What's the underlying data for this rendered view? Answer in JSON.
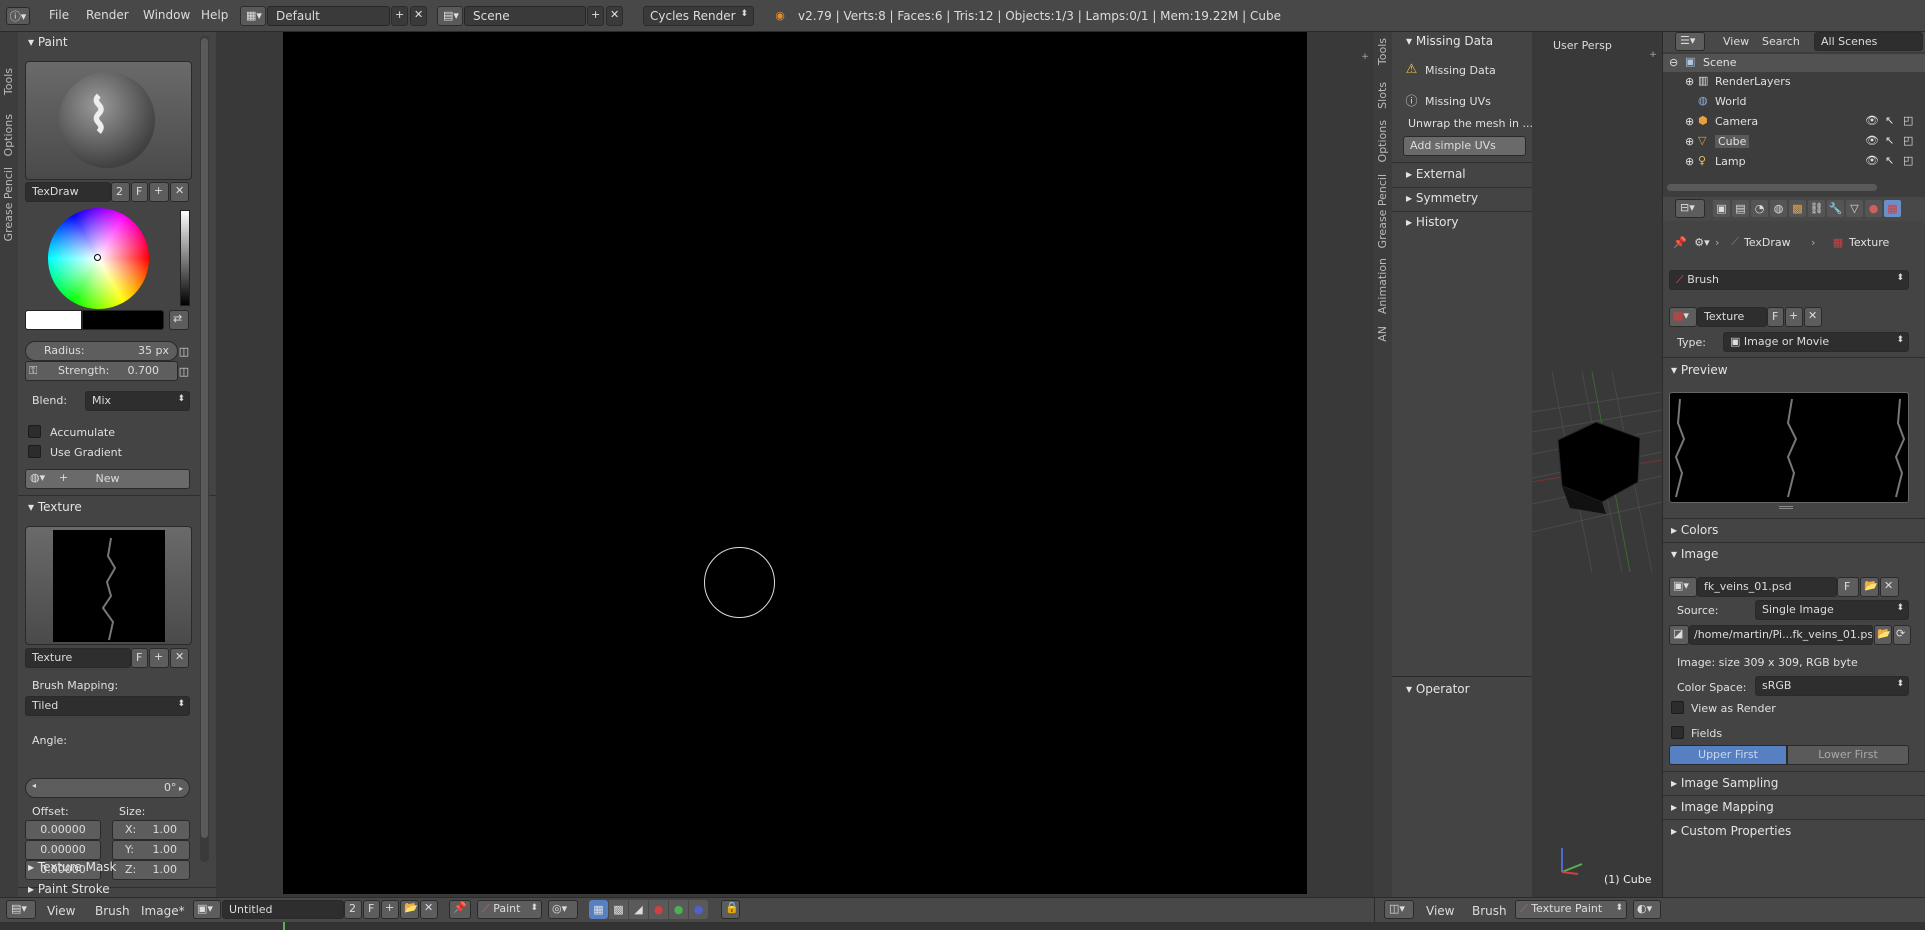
{
  "top_menu": {
    "info_icon": "info-icon",
    "menus": [
      "File",
      "Render",
      "Window",
      "Help"
    ],
    "layout": "Default",
    "scene": "Scene",
    "engine": "Cycles Render",
    "stats": "v2.79 | Verts:8 | Faces:6 | Tris:12 | Objects:1/3 | Lamps:0/1 | Mem:19.22M | Cube"
  },
  "left_tabs": [
    "Tools",
    "Options",
    "Grease Pencil"
  ],
  "left_panel": {
    "paint_header": "Paint",
    "brush_name": "TexDraw",
    "brush_users": "2",
    "fake_user": "F",
    "radius_label": "Radius:",
    "radius_value": "35 px",
    "strength_label": "Strength:",
    "strength_value": "0.700",
    "blend_label": "Blend:",
    "blend_value": "Mix",
    "accumulate": "Accumulate",
    "use_gradient": "Use Gradient",
    "new_label": "New",
    "texture_header": "Texture",
    "texture_name": "Texture",
    "brush_mapping_label": "Brush Mapping:",
    "brush_mapping_value": "Tiled",
    "angle_label": "Angle:",
    "angle_value": "0°",
    "offset_label": "Offset:",
    "size_label": "Size:",
    "offsets": [
      "0.00000",
      "0.00000",
      "0.00000"
    ],
    "sizes": [
      {
        "axis": "X:",
        "value": "1.00"
      },
      {
        "axis": "Y:",
        "value": "1.00"
      },
      {
        "axis": "Z:",
        "value": "1.00"
      }
    ],
    "texture_mask": "Texture Mask",
    "paint_stroke": "Paint Stroke"
  },
  "mid_tabs": [
    "Tools",
    "Slots",
    "Options",
    "Grease Pencil",
    "Animation",
    "AN"
  ],
  "mid_panel": {
    "missing_data_header": "Missing Data",
    "missing_data": "Missing Data",
    "missing_uvs": "Missing UVs",
    "unwrap_text": "Unwrap the mesh in ...",
    "add_simple_uvs": "Add simple UVs",
    "external": "External",
    "symmetry": "Symmetry",
    "history": "History",
    "operator": "Operator"
  },
  "viewport3d": {
    "label": "User Persp",
    "object_label": "(1) Cube"
  },
  "outliner": {
    "view": "View",
    "search": "Search",
    "all_scenes": "All Scenes",
    "items": [
      "Scene",
      "RenderLayers",
      "World",
      "Camera",
      "Cube",
      "Lamp"
    ]
  },
  "properties": {
    "breadcrumb_brush": "TexDraw",
    "breadcrumb_tex": "Texture",
    "brush_field": "Brush",
    "texture_name": "Texture",
    "fake_user": "F",
    "type_label": "Type:",
    "type_value": "Image or Movie",
    "preview_header": "Preview",
    "colors_header": "Colors",
    "image_header": "Image",
    "image_name": "fk_veins_01.psd",
    "source_label": "Source:",
    "source_value": "Single Image",
    "filepath": "/home/martin/Pi...fk_veins_01.psd",
    "image_info": "Image: size 309 x 309, RGB byte",
    "color_space_label": "Color Space:",
    "color_space_value": "sRGB",
    "view_as_render": "View as Render",
    "fields": "Fields",
    "upper_first": "Upper First",
    "lower_first": "Lower First",
    "image_sampling": "Image Sampling",
    "image_mapping": "Image Mapping",
    "custom_properties": "Custom Properties"
  },
  "bottom_left": {
    "menus": [
      "View",
      "Brush",
      "Image*"
    ],
    "image_name": "Untitled",
    "users": "2",
    "fake_user": "F",
    "mode": "Paint"
  },
  "bottom_right": {
    "menus": [
      "View",
      "Brush"
    ],
    "mode": "Texture Paint"
  },
  "colors": {
    "accent_blue": "#5680c2",
    "bg": "#333333",
    "panel": "#444444",
    "canvas": "#000000"
  }
}
